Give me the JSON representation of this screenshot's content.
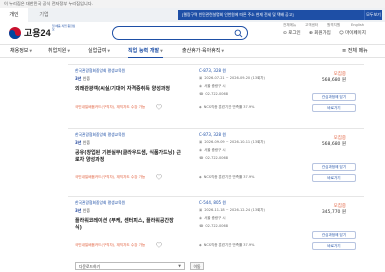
{
  "topbar": {
    "notice": "이 누리집은 대한민국 공식 전자정부 누리집입니다."
  },
  "util": {
    "tab_personal": "개인",
    "tab_company": "기업",
    "banner_text": "[렐랑구역 빈민관련설명회 인천원에 따른 주소 현재 전세 및 택배 공고]",
    "banner_controls": "◀ ▶ 1/5",
    "banner_close": "모두보기"
  },
  "header": {
    "logo_text": "고용24",
    "logo_sub": "일·배움·직업 종합정보",
    "search_placeholder": "",
    "login": "로그인",
    "signup": "회원가입",
    "mypage": "마이페이지",
    "small_links": [
      "전체메뉴",
      "고객센터",
      "원격지원",
      "English"
    ]
  },
  "gnb": {
    "items": [
      "채용정보",
      "취업지원",
      "실업급여",
      "직업 능력 개발",
      "출산휴가·육아휴직"
    ],
    "all_menu": "전체 메뉴"
  },
  "cards": [
    {
      "org": "한국관광협회중앙회 평생교육원",
      "badge_level": "3년",
      "badge_text": "인증",
      "title": "외래관광객(씨실/기대어 자격증취득 양성과정",
      "sub": "국민내일배움카드(구직자), 재직자도 수강 가능",
      "code": "C-873, 328 원",
      "date": "2026-07-21 ~ 2026-09-20 (13회차)",
      "address": "서울 중랑구 시",
      "phone": "02-722-0068",
      "ncs": "NCS직종 훈련기관 만족률 37.9%",
      "status": "모집중",
      "price_now": "568,680 원",
      "btn1": "관심과정에 담기",
      "btn2": "바로가기"
    },
    {
      "org": "한국관광협회중앙회 평생교육원",
      "badge_level": "3년",
      "badge_text": "인증",
      "title": "공유(창업된 기본실무(클라우드샘, 식품가드닝) 근",
      "title2": "로자 양성과정",
      "sub": "국민내일배움카드(구직자), 재직자도 수강 가능",
      "code": "C-873, 328 원",
      "date": "2026-09-09 ~ 2026-10-11 (13회차)",
      "address": "서울 중랑구 시",
      "phone": "02-722-0068",
      "ncs": "NCS직종 훈련기관 만족률 37.9%",
      "status": "모집중",
      "price_now": "568,680 원",
      "btn1": "관심과정에 담기",
      "btn2": "바로가기"
    },
    {
      "org": "한국관광협회중앙회 평생교육원",
      "badge_level": "3년",
      "badge_text": "인증",
      "title": "플라워코레이션 (부케, 센터피스, 플라워공간장",
      "title2": "식)",
      "sub": "국민내일배움카드(구직자), 재직자도 수강 가능",
      "code": "C-544, 805 원",
      "date": "2026-11-18 ~ 2026-12-24 (13회차)",
      "address": "서울 중랑구 시",
      "phone": "02-722-0068",
      "ncs": "NCS직종 훈련기관 만족률 37.9%",
      "status": "모집중",
      "price_now": "345,770 원",
      "btn1": "관심과정에 담기",
      "btn2": "바로가기"
    }
  ],
  "pager": {
    "select_value": "다운로드하기",
    "go": "이동"
  }
}
